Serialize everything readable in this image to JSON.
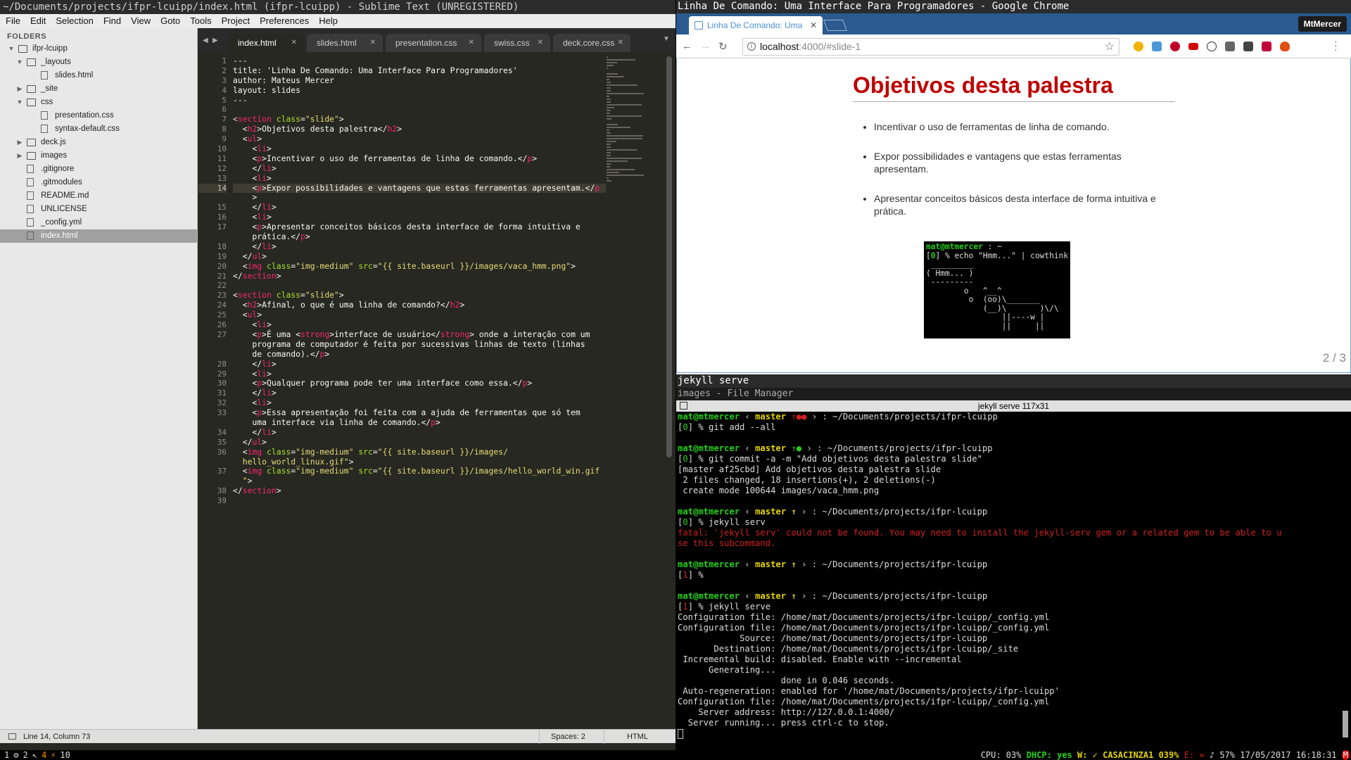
{
  "sublime": {
    "title": "~/Documents/projects/ifpr-lcuipp/index.html (ifpr-lcuipp) - Sublime Text (UNREGISTERED)",
    "menu": [
      "File",
      "Edit",
      "Selection",
      "Find",
      "View",
      "Goto",
      "Tools",
      "Project",
      "Preferences",
      "Help"
    ],
    "sidebar": {
      "header": "FOLDERS",
      "items": [
        {
          "label": "ifpr-lcuipp",
          "depth": 0,
          "type": "folder",
          "open": true
        },
        {
          "label": "_layouts",
          "depth": 1,
          "type": "folder",
          "open": true
        },
        {
          "label": "slides.html",
          "depth": 2,
          "type": "file"
        },
        {
          "label": "_site",
          "depth": 1,
          "type": "folder",
          "open": false
        },
        {
          "label": "css",
          "depth": 1,
          "type": "folder",
          "open": true
        },
        {
          "label": "presentation.css",
          "depth": 2,
          "type": "file"
        },
        {
          "label": "syntax-default.css",
          "depth": 2,
          "type": "file"
        },
        {
          "label": "deck.js",
          "depth": 1,
          "type": "folder",
          "open": false
        },
        {
          "label": "images",
          "depth": 1,
          "type": "folder",
          "open": false
        },
        {
          "label": ".gitignore",
          "depth": 1,
          "type": "file"
        },
        {
          "label": ".gitmodules",
          "depth": 1,
          "type": "file"
        },
        {
          "label": "README.md",
          "depth": 1,
          "type": "file"
        },
        {
          "label": "UNLICENSE",
          "depth": 1,
          "type": "file"
        },
        {
          "label": "_config.yml",
          "depth": 1,
          "type": "file"
        },
        {
          "label": "index.html",
          "depth": 1,
          "type": "file",
          "selected": true
        }
      ]
    },
    "tabs": [
      {
        "label": "index.html",
        "active": true
      },
      {
        "label": "slides.html"
      },
      {
        "label": "presentation.css"
      },
      {
        "label": "swiss.css"
      },
      {
        "label": "deck.core.css"
      }
    ],
    "gutter": [
      "1",
      "2",
      "3",
      "4",
      "5",
      "6",
      "7",
      "8",
      "9",
      "10",
      "11",
      "12",
      "13",
      "14",
      "",
      "15",
      "16",
      "17",
      "",
      "18",
      "19",
      "20",
      "21",
      "22",
      "23",
      "24",
      "25",
      "26",
      "27",
      "",
      "",
      "28",
      "29",
      "30",
      "31",
      "32",
      "33",
      "",
      "34",
      "35",
      "36",
      "",
      "37",
      "",
      "38",
      "39"
    ],
    "current_line": 14,
    "code": [
      [
        [
          "---",
          ""
        ]
      ],
      [
        [
          "title: 'Linha De Comando: Uma Interface Para Programadores'",
          ""
        ]
      ],
      [
        [
          "author: Mateus Mercer",
          ""
        ]
      ],
      [
        [
          "layout: slides",
          ""
        ]
      ],
      [
        [
          "---",
          ""
        ]
      ],
      [
        [
          "",
          ""
        ]
      ],
      [
        [
          "<",
          "w"
        ],
        [
          "section",
          "t"
        ],
        [
          " ",
          ""
        ],
        [
          "class",
          "a"
        ],
        [
          "=",
          ""
        ],
        [
          "\"slide\"",
          "s"
        ],
        [
          ">",
          ""
        ]
      ],
      [
        [
          "  <",
          ""
        ],
        [
          "h2",
          "t"
        ],
        [
          ">Objetivos desta palestra</",
          ""
        ],
        [
          "h2",
          "t"
        ],
        [
          ">",
          ""
        ]
      ],
      [
        [
          "  <",
          ""
        ],
        [
          "ul",
          "t"
        ],
        [
          ">",
          ""
        ]
      ],
      [
        [
          "    <",
          ""
        ],
        [
          "li",
          "t"
        ],
        [
          ">",
          ""
        ]
      ],
      [
        [
          "    <",
          ""
        ],
        [
          "p",
          "t"
        ],
        [
          ">Incentivar o uso de ferramentas de linha de comando.</",
          ""
        ],
        [
          "p",
          "t"
        ],
        [
          ">",
          ""
        ]
      ],
      [
        [
          "    </",
          ""
        ],
        [
          "li",
          "t"
        ],
        [
          ">",
          ""
        ]
      ],
      [
        [
          "    <",
          ""
        ],
        [
          "li",
          "t"
        ],
        [
          ">",
          ""
        ]
      ],
      [
        [
          "    <",
          ""
        ],
        [
          "p",
          "t"
        ],
        [
          ">Expor possibilidades e vantagens que estas ferramentas apresentam.</",
          ""
        ],
        [
          "p",
          "t"
        ]
      ],
      [
        [
          "    >",
          ""
        ]
      ],
      [
        [
          "    </",
          ""
        ],
        [
          "li",
          "t"
        ],
        [
          ">",
          ""
        ]
      ],
      [
        [
          "    <",
          ""
        ],
        [
          "li",
          "t"
        ],
        [
          ">",
          ""
        ]
      ],
      [
        [
          "    <",
          ""
        ],
        [
          "p",
          "t"
        ],
        [
          ">Apresentar conceitos básicos desta interface de forma intuitiva e",
          ""
        ]
      ],
      [
        [
          "    prática.</",
          ""
        ],
        [
          "p",
          "t"
        ],
        [
          ">",
          ""
        ]
      ],
      [
        [
          "    </",
          ""
        ],
        [
          "li",
          "t"
        ],
        [
          ">",
          ""
        ]
      ],
      [
        [
          "  </",
          ""
        ],
        [
          "ul",
          "t"
        ],
        [
          ">",
          ""
        ]
      ],
      [
        [
          "  <",
          ""
        ],
        [
          "img",
          "t"
        ],
        [
          " ",
          ""
        ],
        [
          "class",
          "a"
        ],
        [
          "=",
          ""
        ],
        [
          "\"img-medium\"",
          "s"
        ],
        [
          " ",
          ""
        ],
        [
          "src",
          "a"
        ],
        [
          "=",
          ""
        ],
        [
          "\"{{ site.baseurl }}/images/vaca_hmm.png\"",
          "s"
        ],
        [
          ">",
          ""
        ]
      ],
      [
        [
          "</",
          ""
        ],
        [
          "section",
          "t"
        ],
        [
          ">",
          ""
        ]
      ],
      [
        [
          "",
          ""
        ]
      ],
      [
        [
          "<",
          ""
        ],
        [
          "section",
          "t"
        ],
        [
          " ",
          ""
        ],
        [
          "class",
          "a"
        ],
        [
          "=",
          ""
        ],
        [
          "\"slide\"",
          "s"
        ],
        [
          ">",
          ""
        ]
      ],
      [
        [
          "  <",
          ""
        ],
        [
          "h2",
          "t"
        ],
        [
          ">Afinal, o que é uma linha de comando?</",
          ""
        ],
        [
          "h2",
          "t"
        ],
        [
          ">",
          ""
        ]
      ],
      [
        [
          "  <",
          ""
        ],
        [
          "ul",
          "t"
        ],
        [
          ">",
          ""
        ]
      ],
      [
        [
          "    <",
          ""
        ],
        [
          "li",
          "t"
        ],
        [
          ">",
          ""
        ]
      ],
      [
        [
          "    <",
          ""
        ],
        [
          "p",
          "t"
        ],
        [
          ">É uma <",
          ""
        ],
        [
          "strong",
          "t"
        ],
        [
          ">interface de usuário</",
          ""
        ],
        [
          "strong",
          "t"
        ],
        [
          "> onde a interação com um",
          ""
        ]
      ],
      [
        [
          "    programa de computador é feita por sucessivas linhas de texto (linhas",
          ""
        ]
      ],
      [
        [
          "    de comando).</",
          ""
        ],
        [
          "p",
          "t"
        ],
        [
          ">",
          ""
        ]
      ],
      [
        [
          "    </",
          ""
        ],
        [
          "li",
          "t"
        ],
        [
          ">",
          ""
        ]
      ],
      [
        [
          "    <",
          ""
        ],
        [
          "li",
          "t"
        ],
        [
          ">",
          ""
        ]
      ],
      [
        [
          "    <",
          ""
        ],
        [
          "p",
          "t"
        ],
        [
          ">Qualquer programa pode ter uma interface como essa.</",
          ""
        ],
        [
          "p",
          "t"
        ],
        [
          ">",
          ""
        ]
      ],
      [
        [
          "    </",
          ""
        ],
        [
          "li",
          "t"
        ],
        [
          ">",
          ""
        ]
      ],
      [
        [
          "    <",
          ""
        ],
        [
          "li",
          "t"
        ],
        [
          ">",
          ""
        ]
      ],
      [
        [
          "    <",
          ""
        ],
        [
          "p",
          "t"
        ],
        [
          ">Essa apresentação foi feita com a ajuda de ferramentas que só tem",
          ""
        ]
      ],
      [
        [
          "    uma interface via linha de comando.</",
          ""
        ],
        [
          "p",
          "t"
        ],
        [
          ">",
          ""
        ]
      ],
      [
        [
          "    </",
          ""
        ],
        [
          "li",
          "t"
        ],
        [
          ">",
          ""
        ]
      ],
      [
        [
          "  </",
          ""
        ],
        [
          "ul",
          "t"
        ],
        [
          ">",
          ""
        ]
      ],
      [
        [
          "  <",
          ""
        ],
        [
          "img",
          "t"
        ],
        [
          " ",
          ""
        ],
        [
          "class",
          "a"
        ],
        [
          "=",
          ""
        ],
        [
          "\"img-medium\"",
          "s"
        ],
        [
          " ",
          ""
        ],
        [
          "src",
          "a"
        ],
        [
          "=",
          ""
        ],
        [
          "\"{{ site.baseurl }}/images/",
          "s"
        ]
      ],
      [
        [
          "  hello_world_linux.gif\"",
          "s"
        ],
        [
          ">",
          ""
        ]
      ],
      [
        [
          "  <",
          ""
        ],
        [
          "img",
          "t"
        ],
        [
          " ",
          ""
        ],
        [
          "class",
          "a"
        ],
        [
          "=",
          ""
        ],
        [
          "\"img-medium\"",
          "s"
        ],
        [
          " ",
          ""
        ],
        [
          "src",
          "a"
        ],
        [
          "=",
          ""
        ],
        [
          "\"{{ site.baseurl }}/images/hello_world_win.gif",
          "s"
        ]
      ],
      [
        [
          "  \"",
          "s"
        ],
        [
          ">",
          ""
        ]
      ],
      [
        [
          "</",
          ""
        ],
        [
          "section",
          "t"
        ],
        [
          ">",
          ""
        ]
      ],
      [
        [
          "",
          ""
        ]
      ]
    ],
    "status": {
      "position": "Line 14, Column 73",
      "spaces": "Spaces: 2",
      "syntax": "HTML"
    }
  },
  "chrome": {
    "title": "Linha De Comando: Uma Interface Para Programadores - Google Chrome",
    "tab_label": "Linha De Comando: Uma",
    "profile": "MtMercer",
    "url_host": "localhost",
    "url_path": ":4000/#slide-1",
    "slide": {
      "title": "Objetivos desta palestra",
      "bullets": [
        "Incentivar o uso de ferramentas de linha de comando.",
        "Expor possibilidades e vantagens que estas ferramentas apresentam.",
        "Apresentar conceitos básicos desta interface de forma intuitiva e prática."
      ],
      "image_lines": [
        [
          [
            "mat@mtmercer",
            "g"
          ],
          [
            " : ~",
            "w"
          ]
        ],
        [
          [
            "[",
            "w"
          ],
          [
            "0",
            "g"
          ],
          [
            "] % echo \"Hmm...\" | cowthink",
            "w"
          ]
        ],
        [
          [
            " _________",
            "w"
          ]
        ],
        [
          [
            "( Hmm... )",
            "w"
          ]
        ],
        [
          [
            " ---------",
            "w"
          ]
        ],
        [
          [
            "        o   ^__^",
            "w"
          ]
        ],
        [
          [
            "         o  (oo)\\_______",
            "w"
          ]
        ],
        [
          [
            "            (__)\\       )\\/\\",
            "w"
          ]
        ],
        [
          [
            "                ||----w |",
            "w"
          ]
        ],
        [
          [
            "                ||     ||",
            "w"
          ]
        ]
      ],
      "counter": "2 / 3"
    }
  },
  "terminal": {
    "window_title": "jekyll serve",
    "fm_title": "images - File Manager",
    "header": "jekyll serve 117x31",
    "lines": [
      [
        [
          "mat@mtmercer",
          "gb"
        ],
        [
          " ‹ ",
          "w"
        ],
        [
          "master",
          "y"
        ],
        [
          " ↑●● ",
          "r"
        ],
        [
          "› : ~/Documents/projects/ifpr-lcuipp",
          "w"
        ]
      ],
      [
        [
          "[",
          "w"
        ],
        [
          "0",
          "g"
        ],
        [
          "] % git add --all",
          "w"
        ]
      ],
      [
        [
          "",
          ""
        ]
      ],
      [
        [
          "mat@mtmercer",
          "gb"
        ],
        [
          " ‹ ",
          "w"
        ],
        [
          "master",
          "y"
        ],
        [
          " ↑● ",
          "g"
        ],
        [
          "› : ~/Documents/projects/ifpr-lcuipp",
          "w"
        ]
      ],
      [
        [
          "[",
          "w"
        ],
        [
          "0",
          "g"
        ],
        [
          "] % git commit -a -m \"Add objetivos desta palestra slide\"",
          "w"
        ]
      ],
      [
        [
          "[master af25cbd] Add objetivos desta palestra slide",
          "w"
        ]
      ],
      [
        [
          " 2 files changed, 18 insertions(+), 2 deletions(-)",
          "w"
        ]
      ],
      [
        [
          " create mode 100644 images/vaca_hmm.png",
          "w"
        ]
      ],
      [
        [
          "",
          ""
        ]
      ],
      [
        [
          "mat@mtmercer",
          "gb"
        ],
        [
          " ‹ ",
          "w"
        ],
        [
          "master",
          "y"
        ],
        [
          " ↑ ",
          "y"
        ],
        [
          "› : ~/Documents/projects/ifpr-lcuipp",
          "w"
        ]
      ],
      [
        [
          "[",
          "w"
        ],
        [
          "0",
          "g"
        ],
        [
          "] % jekyll serv",
          "w"
        ]
      ],
      [
        [
          "fatal: 'jekyll serv' could not be found. You may need to install the jekyll-serv gem or a related gem to be able to u",
          "r"
        ]
      ],
      [
        [
          "se this subcommand.",
          "r"
        ]
      ],
      [
        [
          "",
          ""
        ]
      ],
      [
        [
          "mat@mtmercer",
          "gb"
        ],
        [
          " ‹ ",
          "w"
        ],
        [
          "master",
          "y"
        ],
        [
          " ↑ ",
          "y"
        ],
        [
          "› : ~/Documents/projects/ifpr-lcuipp",
          "w"
        ]
      ],
      [
        [
          "[",
          "w"
        ],
        [
          "1",
          "r"
        ],
        [
          "] %",
          "w"
        ]
      ],
      [
        [
          "",
          ""
        ]
      ],
      [
        [
          "mat@mtmercer",
          "gb"
        ],
        [
          " ‹ ",
          "w"
        ],
        [
          "master",
          "y"
        ],
        [
          " ↑ ",
          "y"
        ],
        [
          "› : ~/Documents/projects/ifpr-lcuipp",
          "w"
        ]
      ],
      [
        [
          "[",
          "w"
        ],
        [
          "1",
          "r"
        ],
        [
          "] % jekyll serve",
          "w"
        ]
      ],
      [
        [
          "Configuration file: /home/mat/Documents/projects/ifpr-lcuipp/_config.yml",
          "w"
        ]
      ],
      [
        [
          "Configuration file: /home/mat/Documents/projects/ifpr-lcuipp/_config.yml",
          "w"
        ]
      ],
      [
        [
          "            Source: /home/mat/Documents/projects/ifpr-lcuipp",
          "w"
        ]
      ],
      [
        [
          "       Destination: /home/mat/Documents/projects/ifpr-lcuipp/_site",
          "w"
        ]
      ],
      [
        [
          " Incremental build: disabled. Enable with --incremental",
          "w"
        ]
      ],
      [
        [
          "      Generating...",
          "w"
        ]
      ],
      [
        [
          "                    done in 0.046 seconds.",
          "w"
        ]
      ],
      [
        [
          " Auto-regeneration: enabled for '/home/mat/Documents/projects/ifpr-lcuipp'",
          "w"
        ]
      ],
      [
        [
          "Configuration file: /home/mat/Documents/projects/ifpr-lcuipp/_config.yml",
          "w"
        ]
      ],
      [
        [
          "    Server address: http://127.0.0.1:4000/",
          "w"
        ]
      ],
      [
        [
          "  Server running... press ctrl-c to stop.",
          "w"
        ]
      ]
    ]
  },
  "statusbar": {
    "workspaces": [
      "1",
      "2",
      "4",
      "10"
    ],
    "cpu": "CPU: 03%",
    "dhcp": "DHCP: yes",
    "wifi": "W: ✓ CASACINZA1 039%",
    "eth": "E: ✕",
    "battery": "57%",
    "datetime": "17/05/2017  16:18:31"
  }
}
